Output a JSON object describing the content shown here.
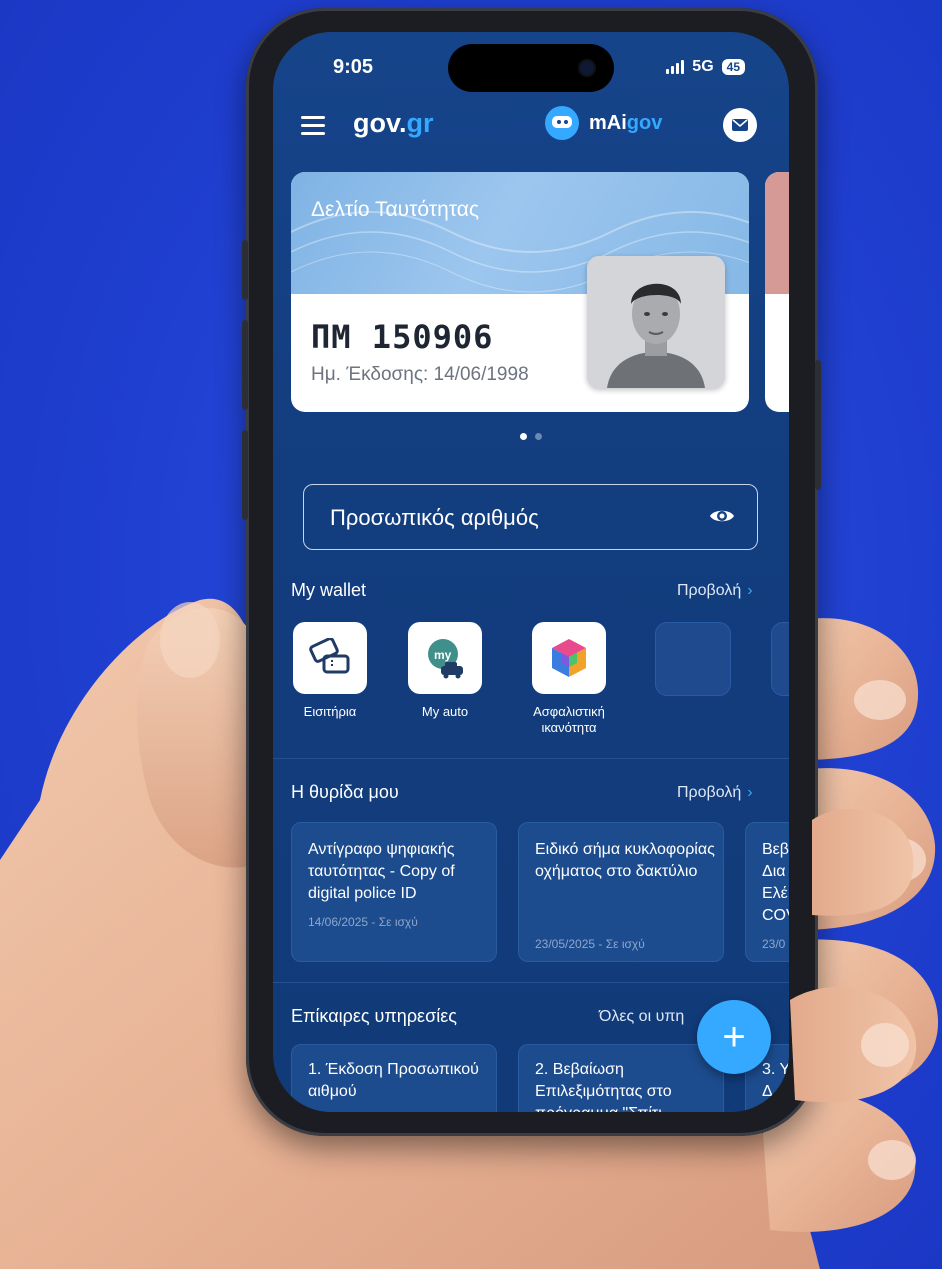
{
  "status": {
    "time": "9:05",
    "network": "5G",
    "battery": "45"
  },
  "header": {
    "brand_main": "gov.",
    "brand_suffix": "gr",
    "assistant_main": "mAi",
    "assistant_suffix": "gov"
  },
  "id_card": {
    "title": "Δελτίο Ταυτότητας",
    "number": "ΠΜ 150906",
    "issue_date": "Ημ. Έκδοσης: 14/06/1998"
  },
  "personal_number": {
    "label": "Προσωπικός αριθμός"
  },
  "wallet": {
    "title": "My wallet",
    "view_label": "Προβολή",
    "items": [
      {
        "label": "Εισιτήρια",
        "icon": "tickets-icon"
      },
      {
        "label": "My auto",
        "icon": "my-auto-icon"
      },
      {
        "label": "Ασφαλιστική ικανότητα",
        "icon": "insurance-cube-icon"
      }
    ]
  },
  "inbox": {
    "title": "Η θυρίδα μου",
    "view_label": "Προβολή",
    "docs": [
      {
        "title": "Αντίγραφο ψηφιακής ταυτότητας - Copy of digital police ID",
        "meta": "14/06/2025 - Σε ισχύ"
      },
      {
        "title": "Ειδικό σήμα κυκλοφορίας οχήματος στο δακτύλιο",
        "meta": "23/05/2025 - Σε ισχύ"
      },
      {
        "title": "Βεβ Δια Ελέ COV",
        "meta": "23/0"
      }
    ]
  },
  "services": {
    "title": "Επίκαιρες υπηρεσίες",
    "view_label": "Όλες οι υπη",
    "items": [
      {
        "title": "1. Έκδοση Προσωπικού αιθμού"
      },
      {
        "title": "2. Βεβαίωση Επιλεξιμότητας στο πρόγραμμα \"Σπίτι"
      },
      {
        "title": "3. Υ Δ"
      }
    ]
  },
  "fab": {
    "label": "+"
  },
  "colors": {
    "background": "#1f3fd0",
    "screen": "#16448a",
    "accent": "#35a8ff"
  }
}
